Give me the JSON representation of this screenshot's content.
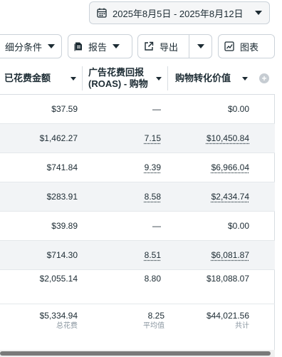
{
  "date_range": {
    "label": "2025年8月5日 - 2025年8月12日"
  },
  "toolbar": {
    "breakdown_label": "细分条件",
    "report_label": "报告",
    "export_label": "导出",
    "chart_label": "图表"
  },
  "table": {
    "columns": [
      {
        "label": "已花费金额"
      },
      {
        "label_line1": "广告花费回报",
        "label_line2": "(ROAS) - 购物"
      },
      {
        "label": "购物转化价值"
      }
    ],
    "rows": [
      {
        "spend": "$37.59",
        "roas": "—",
        "value": "$0.00"
      },
      {
        "spend": "$1,462.27",
        "roas": "7.15",
        "value": "$10,450.84"
      },
      {
        "spend": "$741.84",
        "roas": "9.39",
        "value": "$6,966.04"
      },
      {
        "spend": "$283.91",
        "roas": "8.58",
        "value": "$2,434.74"
      },
      {
        "spend": "$39.89",
        "roas": "—",
        "value": "$0.00"
      },
      {
        "spend": "$714.30",
        "roas": "8.51",
        "value": "$6,081.87"
      },
      {
        "spend": "$2,055.14",
        "roas": "8.80",
        "value": "$18,088.07"
      }
    ],
    "totals": {
      "spend": "$5,334.94",
      "spend_sub": "总花费",
      "roas": "8.25",
      "roas_sub": "平均值",
      "value": "$44,021.56",
      "value_sub": "共计"
    }
  },
  "colors": {
    "border": "#cbd2d9",
    "text": "#1c2b33",
    "muted": "#8a96a0",
    "alt_row": "#f2f4f6"
  },
  "icons": [
    "calendar-icon",
    "chevron-down-icon",
    "report-icon",
    "export-icon",
    "chart-icon",
    "add-column-icon"
  ]
}
